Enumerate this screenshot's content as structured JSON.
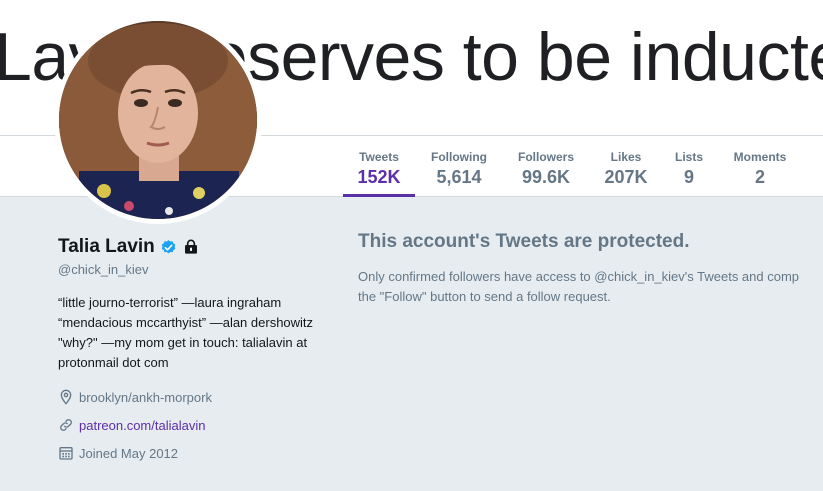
{
  "banner": {
    "text": "Lavin deserves to be inducted."
  },
  "stats": [
    {
      "label": "Tweets",
      "value": "152K",
      "active": true
    },
    {
      "label": "Following",
      "value": "5,614"
    },
    {
      "label": "Followers",
      "value": "99.6K"
    },
    {
      "label": "Likes",
      "value": "207K"
    },
    {
      "label": "Lists",
      "value": "9"
    },
    {
      "label": "Moments",
      "value": "2"
    }
  ],
  "profile": {
    "name": "Talia Lavin",
    "handle": "@chick_in_kiev",
    "bio": "“little journo-terrorist” —laura ingraham “mendacious mccarthyist” —alan dershowitz \"why?\" —my mom get in touch: talialavin at protonmail dot com",
    "location": "brooklyn/ankh-morpork",
    "website": "patreon.com/talialavin",
    "joined": "Joined May 2012",
    "icons": {
      "verified": "verified-badge-icon",
      "protected": "lock-icon",
      "location": "location-pin-icon",
      "website": "link-icon",
      "joined": "calendar-icon"
    }
  },
  "protected_notice": {
    "title": "This account's Tweets are protected.",
    "line1": "Only confirmed followers have access to @chick_in_kiev's Tweets and comp",
    "line2": "the \"Follow\" button to send a follow request."
  },
  "colors": {
    "accent": "#5c2fa8",
    "verified": "#1da1f2",
    "background": "#e6ecf0",
    "muted": "#657786"
  }
}
